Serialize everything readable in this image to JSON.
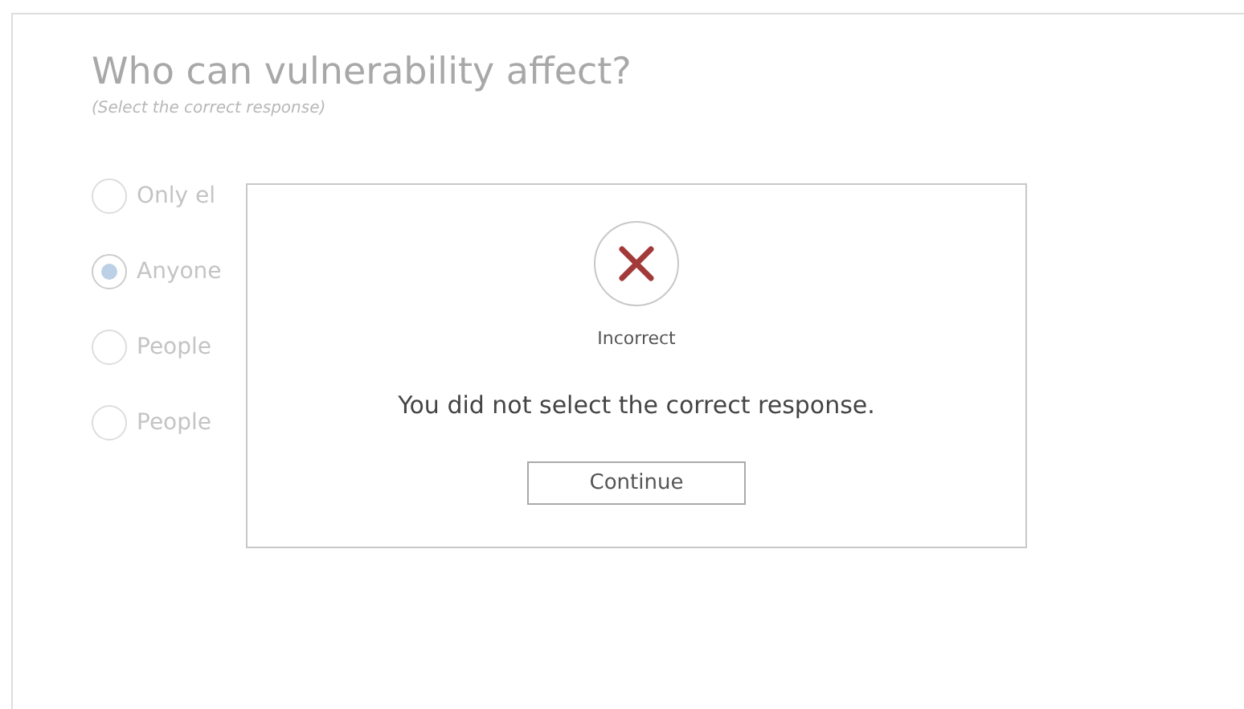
{
  "question": {
    "title": "Who can vulnerability affect?",
    "instruction": "(Select the correct response)"
  },
  "options": [
    {
      "label": "Only el",
      "selected": false
    },
    {
      "label": "Anyone",
      "selected": true
    },
    {
      "label": "People",
      "selected": false
    },
    {
      "label": "People",
      "selected": false
    }
  ],
  "dialog": {
    "status": "Incorrect",
    "message": "You did not select the correct response.",
    "button": "Continue"
  }
}
